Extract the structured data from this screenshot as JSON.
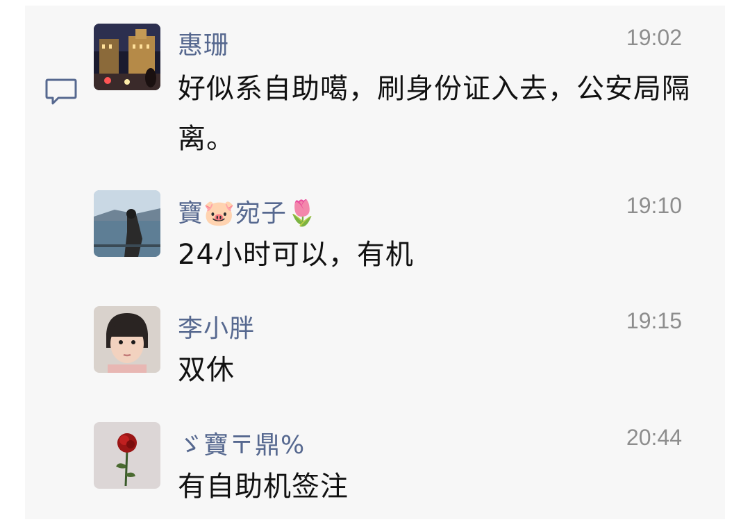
{
  "comments": [
    {
      "name": "惠珊",
      "time": "19:02",
      "text": "好似系自助噶，刷身份证入去，公安局隔离。",
      "avatar": "night-street-photo"
    },
    {
      "name": "寶🐷宛子🌷",
      "time": "19:10",
      "text": "24小时可以，有机",
      "avatar": "woman-by-sea-photo"
    },
    {
      "name": "李小胖",
      "time": "19:15",
      "text": "双休",
      "avatar": "child-portrait-photo"
    },
    {
      "name": "ゞ寶〒鼎%",
      "time": "20:44",
      "text": "有自助机签注",
      "avatar": "red-rose-photo"
    }
  ],
  "icons": {
    "comment": "speech-bubble-icon"
  },
  "colors": {
    "name": "#56688f",
    "time": "#8d8d8d",
    "text": "#111111",
    "panel": "#f7f7f7"
  }
}
